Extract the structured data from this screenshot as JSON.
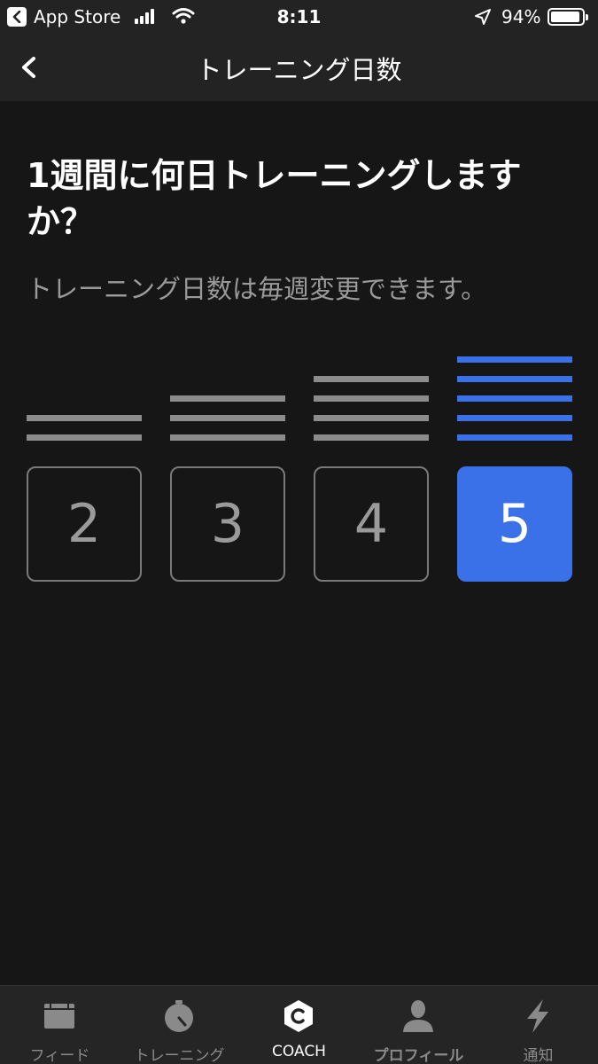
{
  "status_bar": {
    "back_app": "App Store",
    "time": "8:11",
    "battery": "94%"
  },
  "nav": {
    "title": "トレーニング日数",
    "back_icon": "chevron-left-icon"
  },
  "question": "1週間に何日トレーニングしますか？",
  "subtitle": "トレーニング日数は毎週変更できます。",
  "options": [
    {
      "label": "2",
      "selected": false
    },
    {
      "label": "3",
      "selected": false
    },
    {
      "label": "4",
      "selected": false
    },
    {
      "label": "5",
      "selected": true
    }
  ],
  "tabs": [
    {
      "label": "フィード",
      "icon": "feed-icon"
    },
    {
      "label": "トレーニング",
      "icon": "stopwatch-icon"
    },
    {
      "label": "COACH",
      "icon": "coach-icon",
      "active": true
    },
    {
      "label": "プロフィール",
      "icon": "profile-icon"
    },
    {
      "label": "通知",
      "icon": "lightning-icon"
    }
  ],
  "colors": {
    "accent": "#3b71e8",
    "background": "#161616",
    "bar": "#232323"
  }
}
